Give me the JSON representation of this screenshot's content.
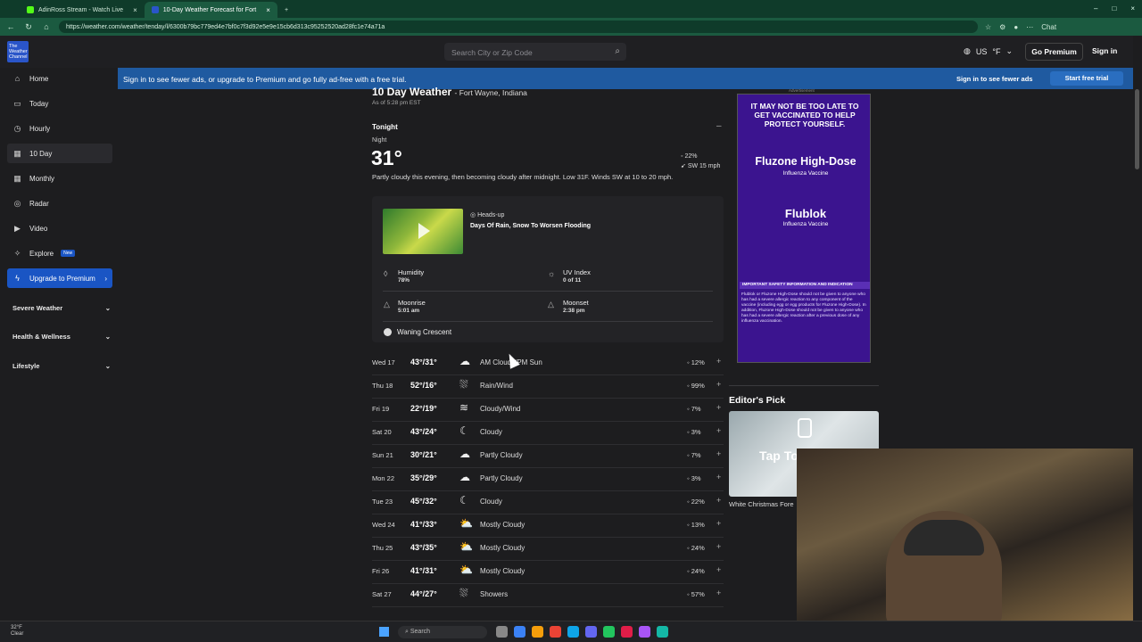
{
  "browser": {
    "tabs": [
      {
        "label": "AdinRoss Stream - Watch Live",
        "color": "#53fc18"
      },
      {
        "label": "10-Day Weather Forecast for Fort",
        "color": "#2a55c9"
      }
    ],
    "url": "https://weather.com/weather/tenday/l/6300b79bc779ed4e7bf0c7f3d92e5e9e15cb6d313c95252520ad28fc1e74a71a",
    "chat_label": "Chat"
  },
  "header": {
    "logo_text": "The Weather Channel",
    "search_placeholder": "Search City or Zip Code",
    "locale": "US",
    "unit": "°F",
    "go_premium": "Go Premium",
    "sign_in": "Sign in"
  },
  "banner": {
    "message": "Sign in to see fewer ads, or upgrade to Premium and go fully ad-free with a free trial.",
    "sign_in_link": "Sign in to see fewer ads",
    "trial_button": "Start free trial"
  },
  "sidebar": {
    "items": [
      {
        "label": "Home"
      },
      {
        "label": "Today"
      },
      {
        "label": "Hourly"
      },
      {
        "label": "10 Day"
      },
      {
        "label": "Monthly"
      },
      {
        "label": "Radar"
      },
      {
        "label": "Video"
      },
      {
        "label": "Explore",
        "badge": "New"
      },
      {
        "label": "Upgrade to Premium"
      }
    ],
    "groups": [
      "Severe Weather",
      "Health & Wellness",
      "Lifestyle"
    ]
  },
  "main": {
    "title": "10 Day Weather",
    "location": "- Fort Wayne, Indiana",
    "as_of": "As of 5:28 pm EST",
    "tonight": {
      "heading": "Tonight",
      "period": "Night",
      "temp": "31°",
      "precip": "22%",
      "wind": "SW 15 mph",
      "narrative": "Partly cloudy this evening, then becoming cloudy after midnight. Low 31F. Winds SW at 10 to 20 mph.",
      "video_label": "Heads-up",
      "video_title": "Days Of Rain, Snow To Worsen Flooding",
      "humidity_label": "Humidity",
      "humidity": "78%",
      "uv_label": "UV Index",
      "uv": "0 of 11",
      "moonrise_label": "Moonrise",
      "moonrise": "5:01 am",
      "moonset_label": "Moonset",
      "moonset": "2:38 pm",
      "moon_phase": "Waning Crescent"
    },
    "days": [
      {
        "day": "Wed 17",
        "temps": "43°/31°",
        "icon": "☁",
        "cond": "AM Clouds/PM Sun",
        "precip": "12%"
      },
      {
        "day": "Thu 18",
        "temps": "52°/16°",
        "icon": "⛆",
        "cond": "Rain/Wind",
        "precip": "99%"
      },
      {
        "day": "Fri 19",
        "temps": "22°/19°",
        "icon": "≋",
        "cond": "Cloudy/Wind",
        "precip": "7%"
      },
      {
        "day": "Sat 20",
        "temps": "43°/24°",
        "icon": "☾",
        "cond": "Cloudy",
        "precip": "3%"
      },
      {
        "day": "Sun 21",
        "temps": "30°/21°",
        "icon": "☁",
        "cond": "Partly Cloudy",
        "precip": "7%"
      },
      {
        "day": "Mon 22",
        "temps": "35°/29°",
        "icon": "☁",
        "cond": "Partly Cloudy",
        "precip": "3%"
      },
      {
        "day": "Tue 23",
        "temps": "45°/32°",
        "icon": "☾",
        "cond": "Cloudy",
        "precip": "22%"
      },
      {
        "day": "Wed 24",
        "temps": "41°/33°",
        "icon": "⛅",
        "cond": "Mostly Cloudy",
        "precip": "13%"
      },
      {
        "day": "Thu 25",
        "temps": "43°/35°",
        "icon": "⛅",
        "cond": "Mostly Cloudy",
        "precip": "24%"
      },
      {
        "day": "Fri 26",
        "temps": "41°/31°",
        "icon": "⛅",
        "cond": "Mostly Cloudy",
        "precip": "24%"
      },
      {
        "day": "Sat 27",
        "temps": "44°/27°",
        "icon": "⛆",
        "cond": "Showers",
        "precip": "57%"
      }
    ]
  },
  "right": {
    "ad_label": "Advertisement",
    "ad_headline": "IT MAY NOT BE TOO LATE TO GET VACCINATED TO HELP PROTECT YOURSELF.",
    "ad_brand1": "Fluzone High-Dose",
    "ad_sub1": "Influenza Vaccine",
    "ad_brand2": "Flublok",
    "ad_sub2": "Influenza Vaccine",
    "ad_isi": "IMPORTANT SAFETY INFORMATION AND INDICATION",
    "ad_fine": "Flublok or Fluzone High-Dose should not be given to anyone who has had a severe allergic reaction to any component of the vaccine (including egg or egg products for Fluzone High-Dose). In addition, Fluzone High-Dose should not be given to anyone who has had a severe allergic reaction after a previous dose of any influenza vaccination.",
    "editors_pick": "Editor's Pick",
    "ep_overlay": "Tap To",
    "ep_caption": "White Christmas Fore"
  },
  "taskbar": {
    "weather_temp": "32°F",
    "weather_cond": "Clear",
    "search": "Search"
  }
}
